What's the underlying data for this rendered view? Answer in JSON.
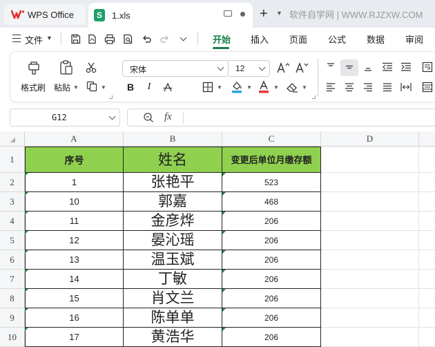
{
  "titlebar": {
    "app_name": "WPS Office",
    "file_name": "1.xls",
    "watermark": "软件自学网 | WWW.RJZXW.COM"
  },
  "menubar": {
    "file_label": "文件",
    "tabs": [
      "开始",
      "插入",
      "页面",
      "公式",
      "数据",
      "审阅"
    ],
    "active_tab": "开始",
    "accent_color": "#1a7f4b"
  },
  "ribbon": {
    "format_painter_label": "格式刷",
    "paste_label": "粘贴",
    "font_name": "宋体",
    "font_size": "12",
    "font_color": "#e53935",
    "fill_color": "#2aa4e0"
  },
  "formula_bar": {
    "cell_ref": "G12",
    "formula": ""
  },
  "sheet": {
    "columns": [
      "A",
      "B",
      "C",
      "D"
    ],
    "rows": [
      "1",
      "2",
      "3",
      "4",
      "5",
      "6",
      "7",
      "8",
      "9",
      "10"
    ],
    "header_fill": "#8fd14f",
    "headers": [
      "序号",
      "姓名",
      "变更后单位月缴存额"
    ],
    "data": [
      {
        "no": "1",
        "name": "张艳平",
        "amount": "523"
      },
      {
        "no": "10",
        "name": "郭嘉",
        "amount": "468"
      },
      {
        "no": "11",
        "name": "金彦烨",
        "amount": "206"
      },
      {
        "no": "12",
        "name": "晏沁瑶",
        "amount": "206"
      },
      {
        "no": "13",
        "name": "温玉斌",
        "amount": "206"
      },
      {
        "no": "14",
        "name": "丁敏",
        "amount": "206"
      },
      {
        "no": "15",
        "name": "肖文兰",
        "amount": "206"
      },
      {
        "no": "16",
        "name": "陈单单",
        "amount": "206"
      },
      {
        "no": "17",
        "name": "黄浩华",
        "amount": "206"
      }
    ]
  }
}
